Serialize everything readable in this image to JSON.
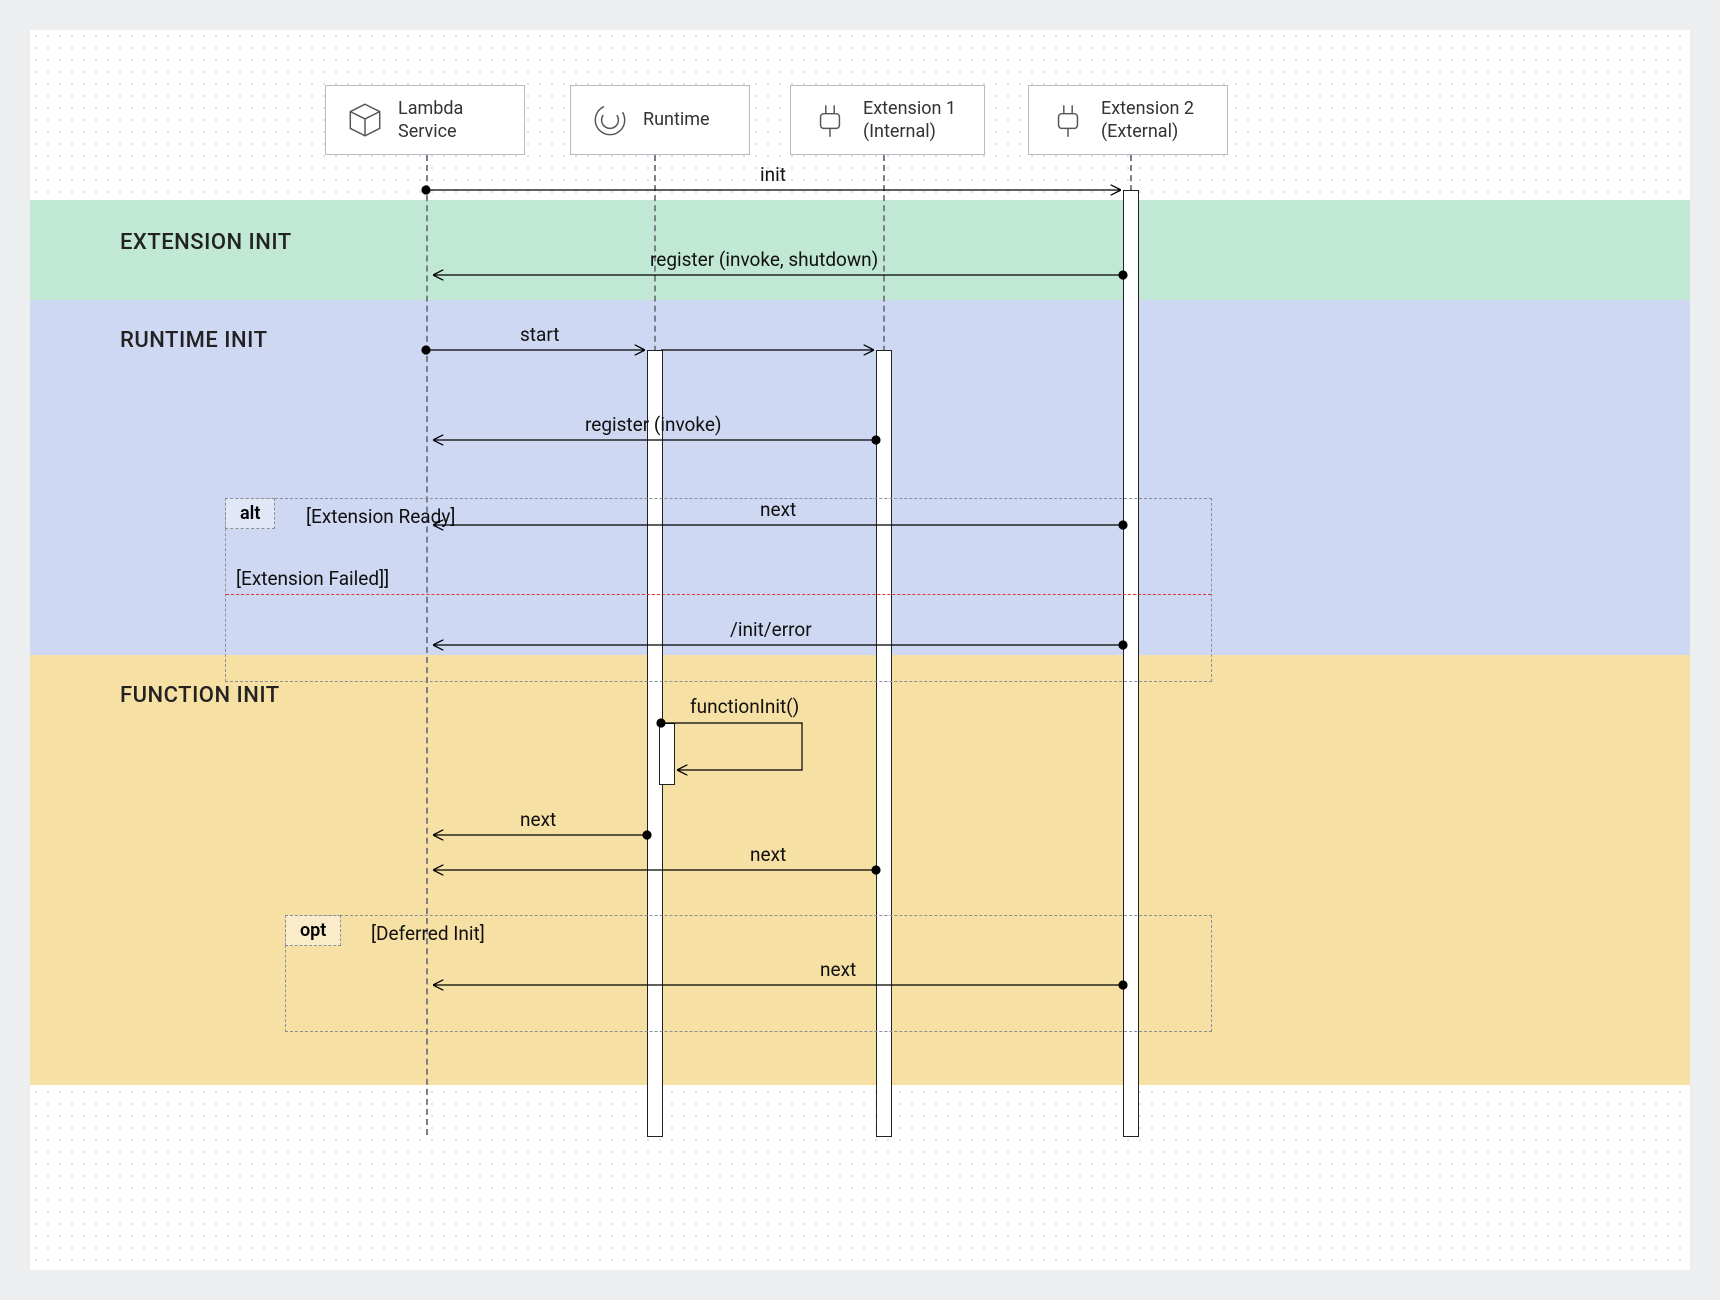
{
  "participants": {
    "lambda": "Lambda\nService",
    "runtime": "Runtime",
    "ext1": "Extension 1\n(Internal)",
    "ext2": "Extension 2\n(External)"
  },
  "phases": {
    "ext_init": "EXTENSION INIT",
    "rt_init": "RUNTIME INIT",
    "fn_init": "FUNCTION INIT"
  },
  "messages": {
    "init": "init",
    "register_ext2": "register (invoke, shutdown)",
    "start": "start",
    "register_ext1": "register (invoke)",
    "next_ext2_a": "next",
    "init_error": "/init/error",
    "fn_init_call": "functionInit()",
    "next_rt": "next",
    "next_ext1_b": "next",
    "next_ext2_c": "next"
  },
  "fragments": {
    "alt_label": "alt",
    "alt_guard_ready": "[Extension Ready]",
    "alt_guard_failed": "[Extension Failed]]",
    "opt_label": "opt",
    "opt_guard": "[Deferred Init]"
  }
}
